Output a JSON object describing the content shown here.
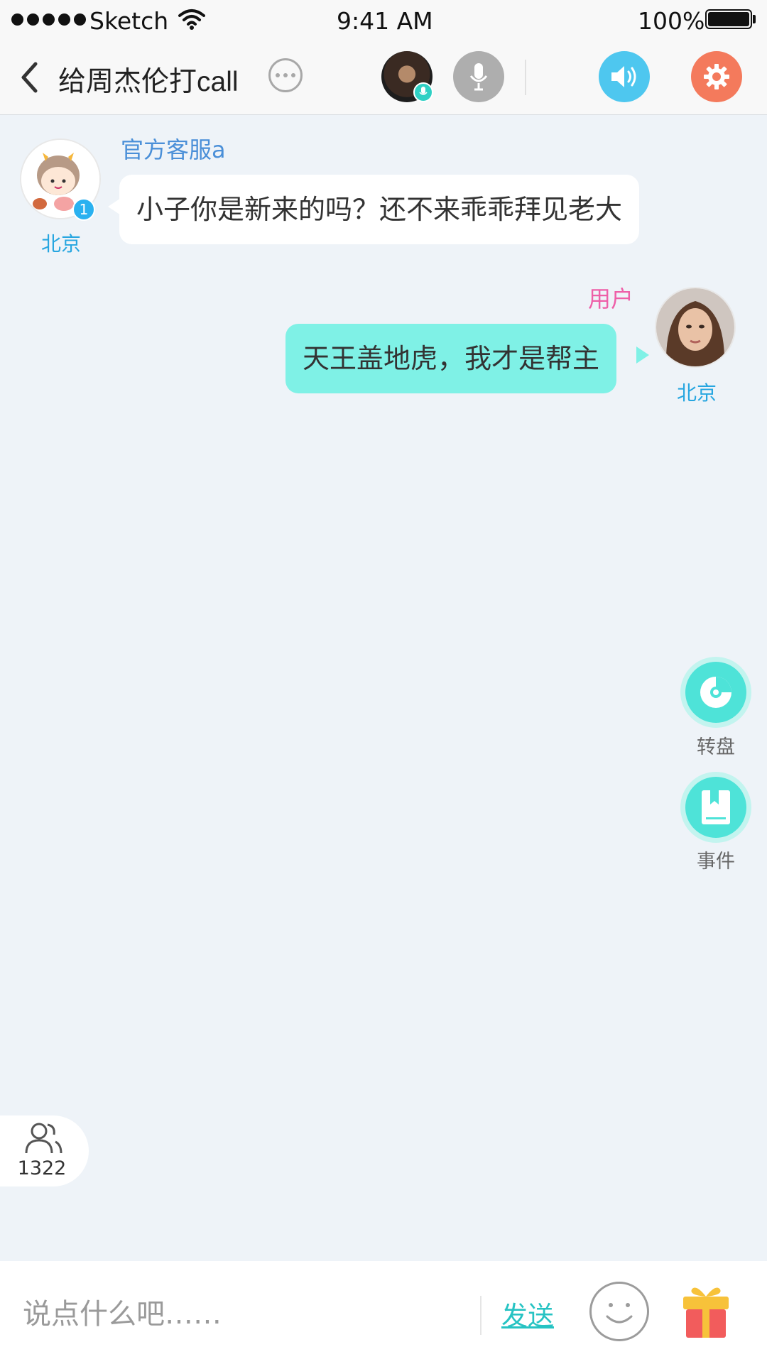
{
  "status_bar": {
    "carrier": "Sketch",
    "time": "9:41 AM",
    "battery": "100%"
  },
  "nav": {
    "title": "给周杰伦打call",
    "icons": {
      "back": "chevron-left-icon",
      "more": "more-dots-icon",
      "mic": "microphone-icon",
      "speaker": "speaker-icon",
      "settings": "gear-icon"
    }
  },
  "messages": [
    {
      "sender": "官方客服a",
      "text": "小子你是新来的吗？还不来乖乖拜见老大",
      "city": "北京",
      "badge": "1",
      "side": "left"
    },
    {
      "sender": "用户",
      "text": "天王盖地虎，我才是帮主",
      "city": "北京",
      "side": "right"
    }
  ],
  "side_tools": [
    {
      "label": "转盘",
      "icon": "turntable-icon"
    },
    {
      "label": "事件",
      "icon": "book-icon"
    }
  ],
  "online": {
    "count": "1322",
    "icon": "users-icon"
  },
  "input_bar": {
    "placeholder": "说点什么吧……",
    "send_label": "发送",
    "emoji_icon": "smiley-icon",
    "gift_icon": "gift-icon"
  },
  "colors": {
    "background": "#eef3f8",
    "accent_teal": "#4ee3d8",
    "self_bubble": "#7ff1e6",
    "speaker_blue": "#4ec7ef",
    "settings_orange": "#f47a5c",
    "sender_blue": "#4a8fd8",
    "user_pink": "#ee5fa8",
    "city_blue": "#27a6e0"
  }
}
